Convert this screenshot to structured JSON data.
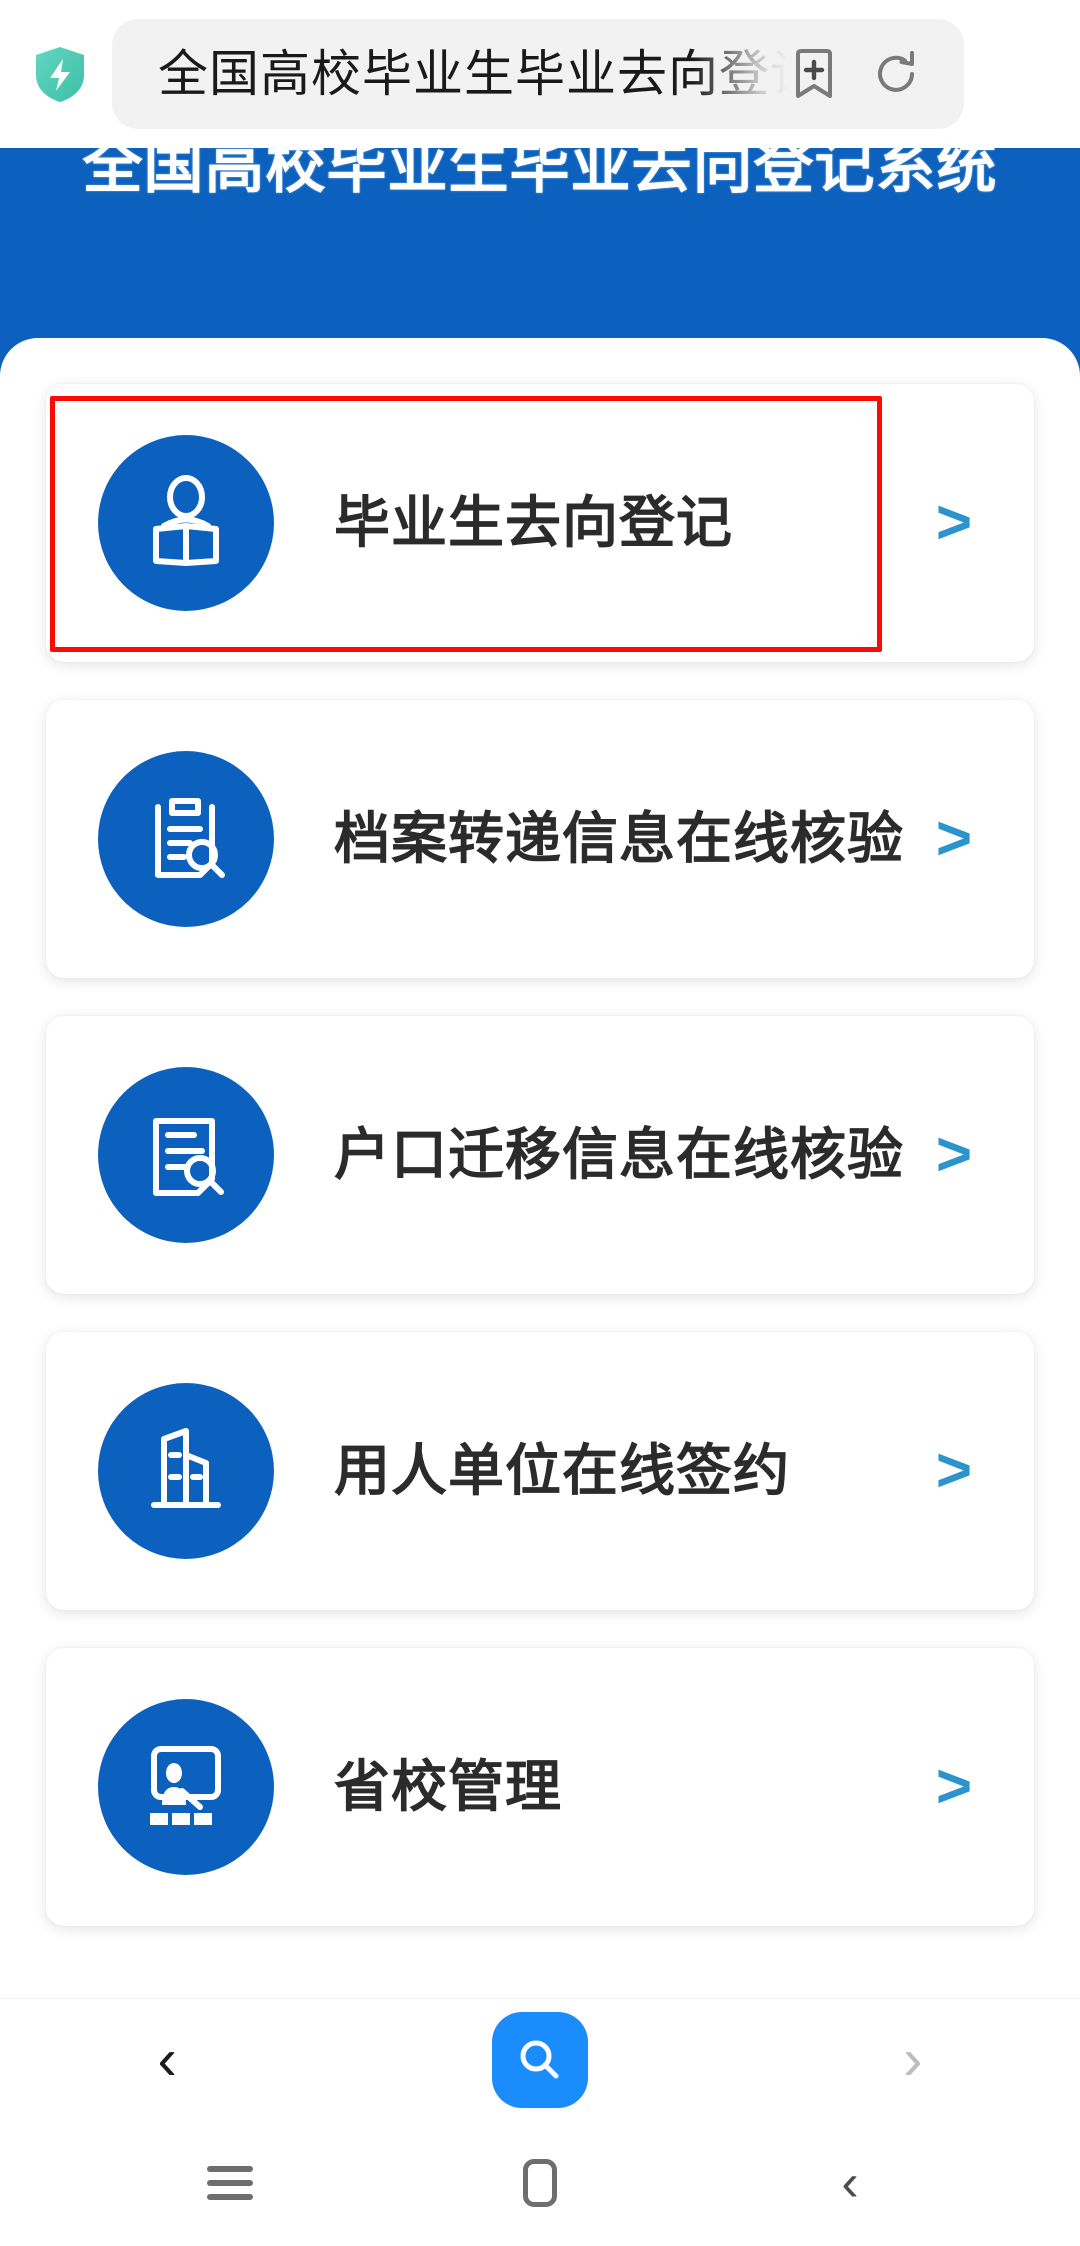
{
  "browser": {
    "security_icon": "shield-lightning-icon",
    "url_text": "全国高校毕业生毕业去向登记系统",
    "bookmark_icon": "bookmark-add-icon",
    "reload_icon": "reload-icon",
    "nav": {
      "back_label": "‹",
      "back_icon": "chevron-left-icon",
      "forward_label": "›",
      "forward_icon": "chevron-right-icon",
      "search_icon": "search-icon"
    }
  },
  "page": {
    "header_title": "全国高校毕业生毕业去向登记系统",
    "header_color": "#0b61bd",
    "accent_color": "#0b61bd",
    "chevron_color": "#2b94cf",
    "highlight_color": "#fb0b06"
  },
  "menu": {
    "items": [
      {
        "label": "毕业生去向登记",
        "icon": "person-reading-book-icon",
        "chevron": ">",
        "highlighted": true
      },
      {
        "label": "档案转递信息在线核验",
        "icon": "document-search-icon",
        "chevron": ">",
        "highlighted": false
      },
      {
        "label": "户口迁移信息在线核验",
        "icon": "household-search-icon",
        "chevron": ">",
        "highlighted": false
      },
      {
        "label": "用人单位在线签约",
        "icon": "building-icon",
        "chevron": ">",
        "highlighted": false
      },
      {
        "label": "省校管理",
        "icon": "classroom-teacher-icon",
        "chevron": ">",
        "highlighted": false
      }
    ]
  },
  "system_nav": {
    "recents_icon": "menu-bars-icon",
    "home_icon": "home-square-icon",
    "back_icon": "chevron-left-icon",
    "back_label": "‹"
  }
}
